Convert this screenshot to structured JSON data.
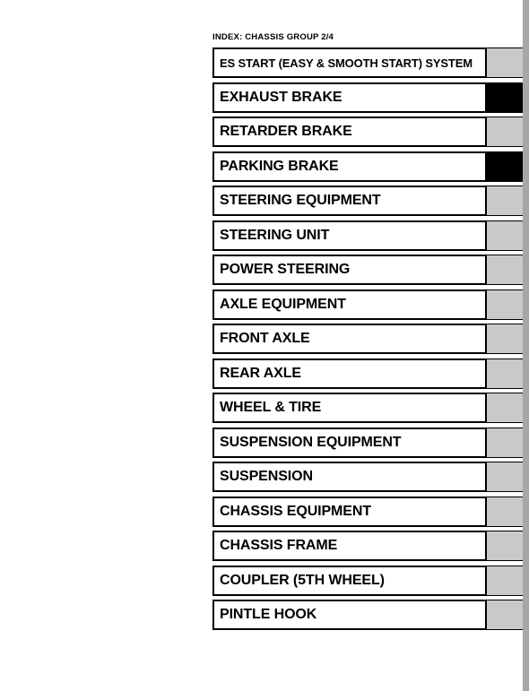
{
  "document": {
    "header": "INDEX: CHASSIS GROUP 2/4",
    "colors": {
      "page_background": "#ffffff",
      "text": "#000000",
      "swatch_gray": "#c9c9c9",
      "swatch_black": "#000000",
      "page_edge_strip": "#a6a6a6",
      "border": "#000000"
    },
    "page_edge_strip_label": ""
  },
  "index": {
    "rows": [
      {
        "label": "ES START (EASY & SMOOTH START) SYSTEM",
        "swatch": "gray",
        "compact": true
      },
      {
        "label": "EXHAUST BRAKE",
        "swatch": "black",
        "compact": false
      },
      {
        "label": "RETARDER BRAKE",
        "swatch": "gray",
        "compact": false
      },
      {
        "label": "PARKING BRAKE",
        "swatch": "black",
        "compact": false
      },
      {
        "label": "STEERING EQUIPMENT",
        "swatch": "gray",
        "compact": false
      },
      {
        "label": "STEERING UNIT",
        "swatch": "gray",
        "compact": false
      },
      {
        "label": "POWER STEERING",
        "swatch": "gray",
        "compact": false
      },
      {
        "label": "AXLE EQUIPMENT",
        "swatch": "gray",
        "compact": false
      },
      {
        "label": "FRONT AXLE",
        "swatch": "gray",
        "compact": false
      },
      {
        "label": "REAR AXLE",
        "swatch": "gray",
        "compact": false
      },
      {
        "label": "WHEEL & TIRE",
        "swatch": "gray",
        "compact": false
      },
      {
        "label": "SUSPENSION EQUIPMENT",
        "swatch": "gray",
        "compact": false
      },
      {
        "label": "SUSPENSION",
        "swatch": "gray",
        "compact": false
      },
      {
        "label": "CHASSIS EQUIPMENT",
        "swatch": "gray",
        "compact": false
      },
      {
        "label": "CHASSIS FRAME",
        "swatch": "gray",
        "compact": false
      },
      {
        "label": "COUPLER (5TH WHEEL)",
        "swatch": "gray",
        "compact": false
      },
      {
        "label": "PINTLE HOOK",
        "swatch": "gray",
        "compact": false
      }
    ]
  }
}
